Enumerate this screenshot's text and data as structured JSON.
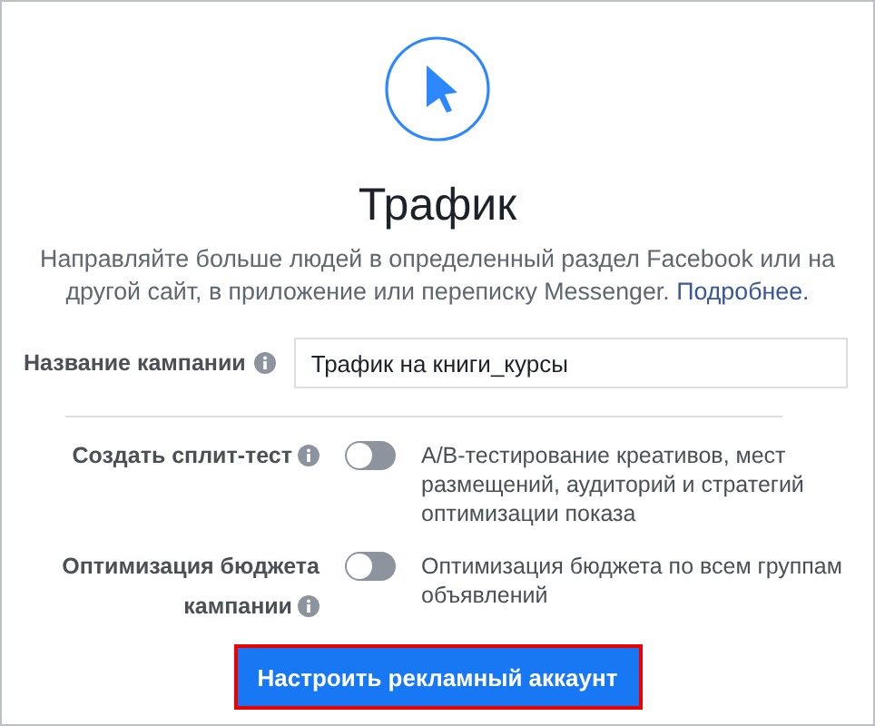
{
  "title": "Трафик",
  "description": {
    "text": "Направляйте больше людей в определенный раздел Facebook или на другой сайт, в приложение или переписку Messenger.",
    "link": "Подробнее."
  },
  "campaign_name": {
    "label": "Название кампании",
    "value": "Трафик на книги_курсы"
  },
  "options": [
    {
      "label": "Создать сплит-тест",
      "on": false,
      "description": "A/B-тестирование креативов, мест размещений, аудиторий и стратегий оптимизации показа"
    },
    {
      "label": "Оптимизация бюджета кампании",
      "on": false,
      "description": "Оптимизация бюджета по всем группам объявлений"
    }
  ],
  "button": {
    "label": "Настроить рекламный аккаунт",
    "highlighted": true
  }
}
